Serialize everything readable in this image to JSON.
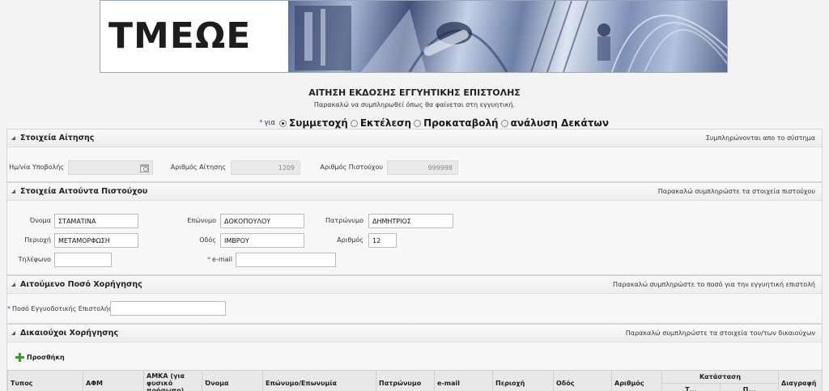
{
  "page": {
    "title": "ΑΙΤΗΣΗ ΕΚΔΟΣΗΣ ΕΓΓΥΗΤΙΚΗΣ ΕΠΙΣΤΟΛΗΣ",
    "subtitle": "Παρακαλώ να συμπληρωθεί όπως θα φαίνεται στη εγγυητική."
  },
  "banner": {
    "logo_text": "TMEΩE"
  },
  "purpose": {
    "required_mark": "*",
    "label": "για",
    "options": [
      "Συμμετοχή",
      "Εκτέλεση",
      "Προκαταβολή",
      "ανάλυση Δεκάτων"
    ],
    "selected": "Συμμετοχή"
  },
  "application": {
    "title": "Στοιχεία Αίτησης",
    "hint": "Συμπληρώνονται απο το σύστημα",
    "date_label": "Ημ/νία Υποβολής",
    "date_value": "",
    "number_label": "Αριθμός Αίτησης",
    "number_value": "1209",
    "creditor_label": "Αριθμός Πιστούχου",
    "creditor_value": "999998"
  },
  "applicant": {
    "title": "Στοιχεία Αιτούντα Πιστούχου",
    "hint": "Παρακαλώ συμπληρώστε τα στοιχεία πιστούχου",
    "first_name_label": "Όνομα",
    "first_name": "ΣΤΑΜΑΤΙΝΑ",
    "last_name_label": "Επώνυμο",
    "last_name": "ΔΟΚΟΠΟΥΛΟΥ",
    "father_label": "Πατρώνυμο",
    "father": "ΔΗΜΗΤΡΙΟΣ",
    "area_label": "Περιοχή",
    "area": "ΜΕΤΑΜΟΡΦΩΣΗ",
    "street_label": "Οδός",
    "street": "ΙΜΒΡΟΥ",
    "number_label": "Αριθμός",
    "number": "12",
    "phone_label": "Τηλέφωνο",
    "phone": "",
    "email_label": "e-mail",
    "email": ""
  },
  "amount": {
    "title": "Αιτούμενο Ποσό Χορήγησης",
    "hint": "Παρακαλώ συμπληρώστε το ποσό για την εγγυητική επιστολή",
    "label": "Ποσό Εγγυοδοτικής Επιστολής",
    "value": ""
  },
  "beneficiaries": {
    "title": "Δικαιούχοι Χορήγησης",
    "hint": "Παρακαλώ συμπληρώστε τα στοιχεία του/των δικαιούχων",
    "add_label": "Προσθήκη",
    "columns": {
      "type": "Τυπος",
      "afm": "ΑΦΜ",
      "amka": "ΑΜΚΑ (για φυσικό πρόσωπο)",
      "name": "Όνομα",
      "surname": "Επώνυμο/Επωνυμία",
      "father": "Πατρώνυμο",
      "email": "e-mail",
      "area": "Περιοχή",
      "street": "Οδός",
      "number": "Αριθμός",
      "status": "Κατάσταση",
      "status_sub1": "Τ...",
      "status_sub2": "Π...",
      "delete": "Διαγραφή"
    }
  }
}
